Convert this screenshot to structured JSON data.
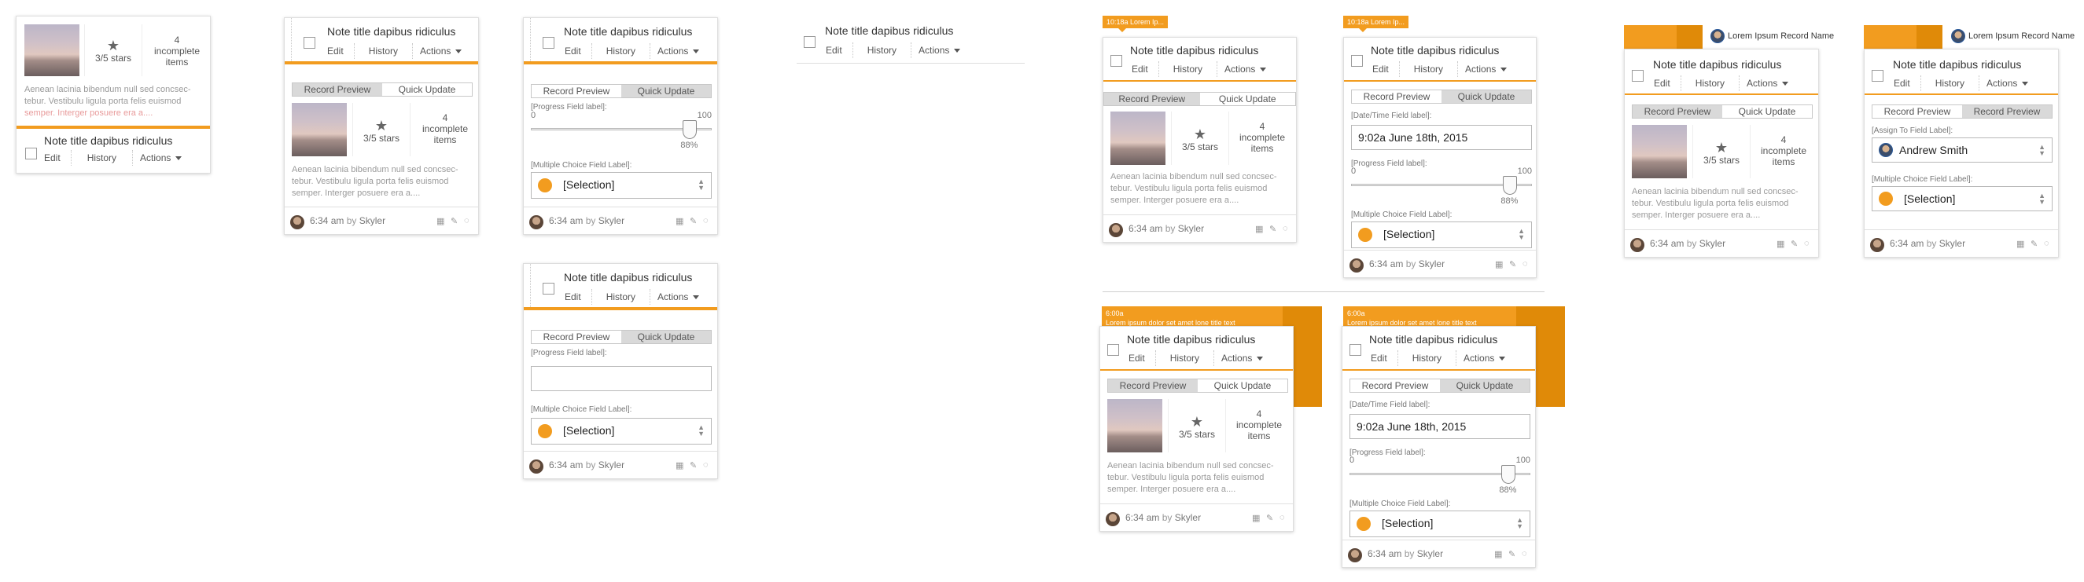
{
  "note_title": "Note title dapibus ridiculus",
  "edit": "Edit",
  "history": "History",
  "actions": "Actions",
  "tab_preview": "Record Preview",
  "tab_quick": "Quick Update",
  "stars": "3/5 stars",
  "incomplete_num": "4",
  "incomplete_l1": "incomplete",
  "incomplete_l2": "items",
  "desc_l1": "Aenean lacinia bibendum null sed concsec-",
  "desc_l2": "tebur. Vestibulu ligula porta felis euismod",
  "desc_l3": "semper. Interger posuere era a....",
  "desc0_l1": "Aenean lacinia bibendum null sed concsec-",
  "desc0_l2": "tebur. Vestibulu ligula porta felis euismod",
  "desc0_l3": "semper. Interger posuere era a....",
  "foot_time": "6:34 am",
  "foot_by": "by",
  "foot_user": "Skyler",
  "progress_label": "[Progress Field label]:",
  "multiple_label": "[Multiple Choice Field Label]:",
  "datetime_label": "[Date/Time Field label]:",
  "assign_label": "[Assign To Field Label]:",
  "slider_min": "0",
  "slider_max": "100",
  "slider_pct": "88%",
  "slider_value": 88,
  "selection": "[Selection]",
  "datetime_value": "9:02a  June 18th, 2015",
  "assignee": "Andrew Smith",
  "tag_text": "10:18a Lorem Ip...",
  "banner_time": "6:00a",
  "banner_text": "Lorem ipsum dolor set amet lone title text",
  "record_name": "Lorem Ipsum Record Name",
  "colors": {
    "accent": "#f29c1f",
    "accent_dark": "#e08a08",
    "border": "#dedede"
  }
}
